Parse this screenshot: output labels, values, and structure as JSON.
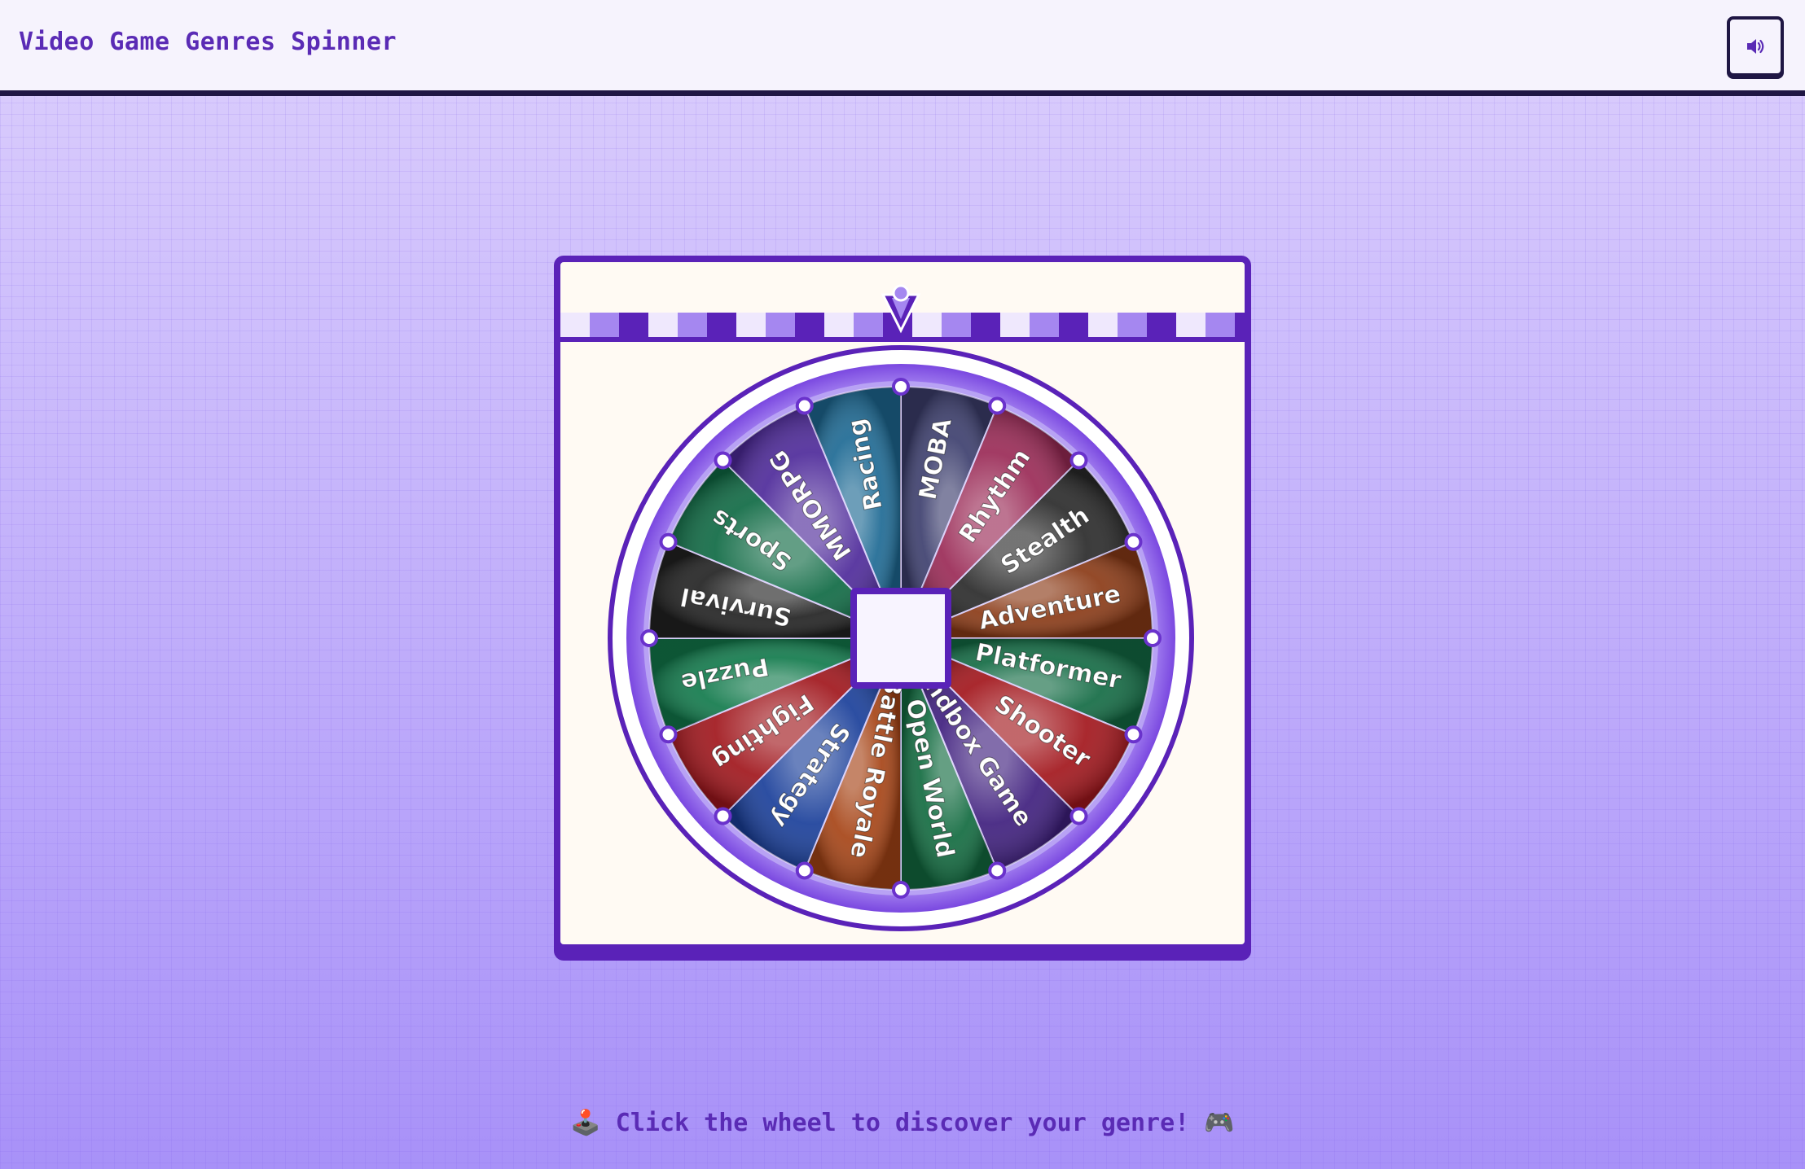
{
  "header": {
    "title": "Video Game Genres Spinner",
    "sound_button_icon": "speaker-volume-icon"
  },
  "wheel": {
    "segments": [
      {
        "label": "MOBA",
        "color": "#3d3f6e"
      },
      {
        "label": "Rhythm",
        "color": "#9a2a56"
      },
      {
        "label": "Stealth",
        "color": "#2a2a2a"
      },
      {
        "label": "Adventure",
        "color": "#8a3a16"
      },
      {
        "label": "Platformer",
        "color": "#136b44"
      },
      {
        "label": "Shooter",
        "color": "#a2161c"
      },
      {
        "label": "Sandbox Game",
        "color": "#3f1f7e"
      },
      {
        "label": "Open World",
        "color": "#126b40"
      },
      {
        "label": "Battle Royale",
        "color": "#a64416"
      },
      {
        "label": "Strategy",
        "color": "#1a3f9a"
      },
      {
        "label": "Fighting",
        "color": "#a0161c"
      },
      {
        "label": "Puzzle",
        "color": "#127a4c"
      },
      {
        "label": "Survival",
        "color": "#222222"
      },
      {
        "label": "Sports",
        "color": "#0f6a44"
      },
      {
        "label": "MMORPG",
        "color": "#4e2a9a"
      },
      {
        "label": "Racing",
        "color": "#1e6a94"
      }
    ],
    "pointer_icon": "pointer-arrow-icon"
  },
  "footer": {
    "hint_text": "🕹️ Click the wheel to discover your genre! 🎮"
  }
}
